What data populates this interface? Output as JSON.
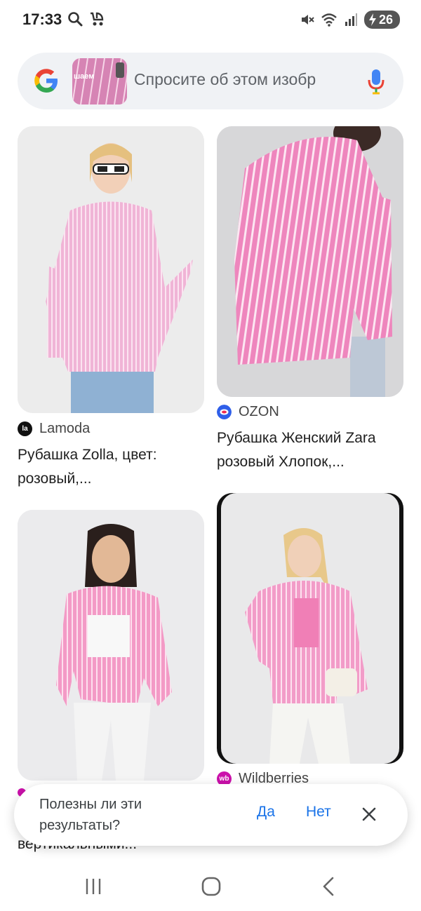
{
  "status": {
    "time": "17:33",
    "battery": "26"
  },
  "search": {
    "thumb_text": "шаем",
    "placeholder": "Спросите об этом изобр"
  },
  "results": [
    {
      "source": "Lamoda",
      "source_icon": "la",
      "title_line1": "Рубашка Zolla, цвет:",
      "title_line2": "розовый,..."
    },
    {
      "source": "OZON",
      "source_icon": "ozon-icon",
      "title_line1": "Рубашка Женский Zara",
      "title_line2": "розовый Хлопок,..."
    },
    {
      "source": "Wildberries",
      "source_icon": "wb"
    }
  ],
  "peek_text": "вертикальными...",
  "feedback": {
    "question": "Полезны ли эти результаты?",
    "yes": "Да",
    "no": "Нет"
  },
  "colors": {
    "accent": "#1a73e8",
    "shirt_pink": "#f4a6cf",
    "searchbar_bg": "#f0f2f5"
  }
}
